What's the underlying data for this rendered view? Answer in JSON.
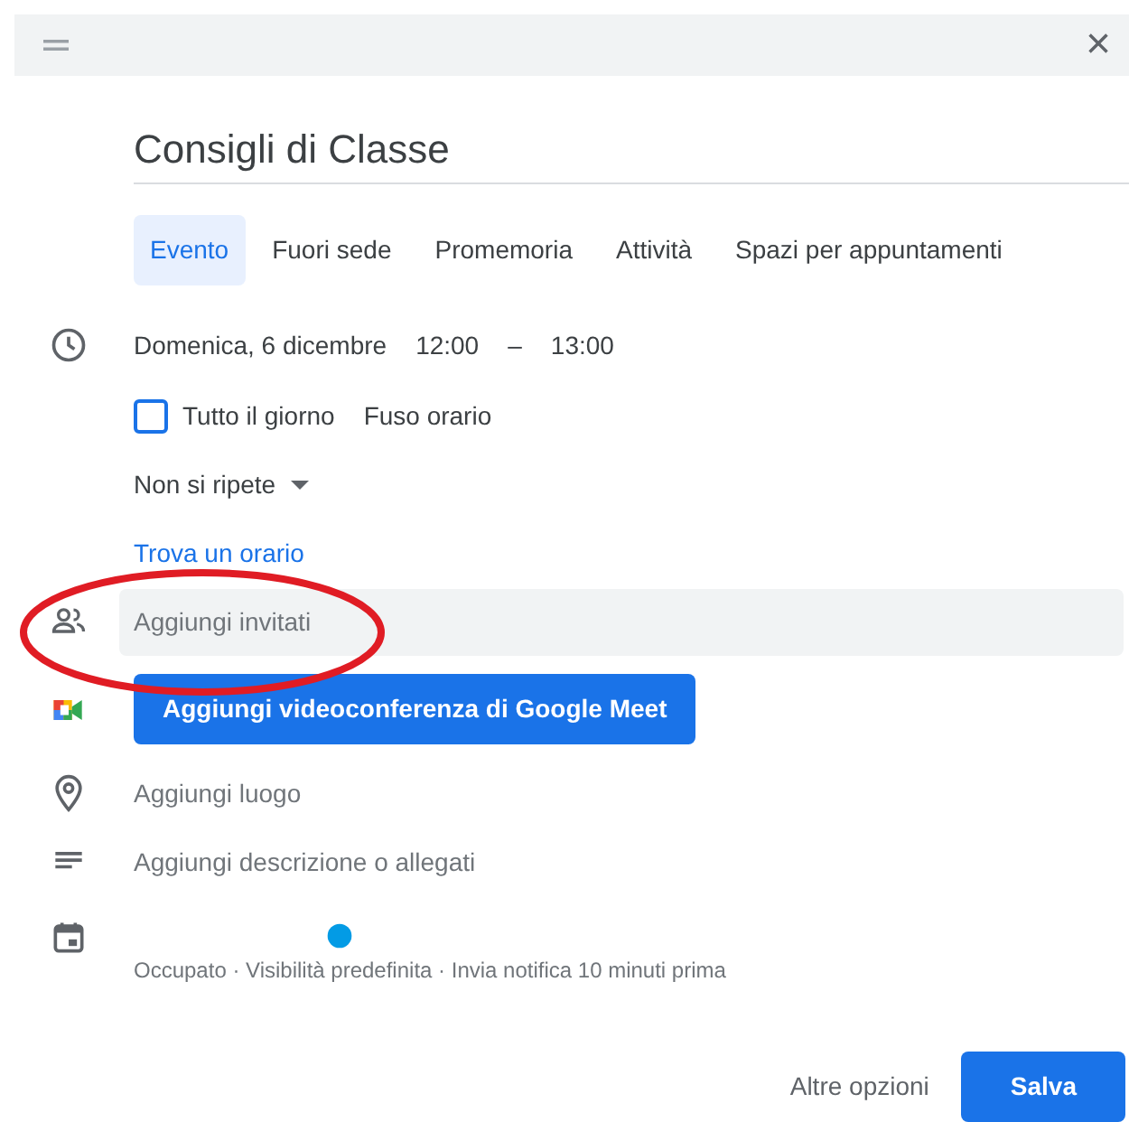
{
  "header": {
    "close_label": "×"
  },
  "title": "Consigli di Classe",
  "tabs": [
    {
      "label": "Evento",
      "selected": true
    },
    {
      "label": "Fuori sede",
      "selected": false
    },
    {
      "label": "Promemoria",
      "selected": false
    },
    {
      "label": "Attività",
      "selected": false
    },
    {
      "label": "Spazi per appuntamenti",
      "selected": false
    }
  ],
  "when": {
    "date": "Domenica, 6 dicembre",
    "start": "12:00",
    "separator": "–",
    "end": "13:00"
  },
  "all_day": {
    "label": "Tutto il giorno",
    "checked": false
  },
  "time_zone": "Fuso orario",
  "repeat": "Non si ripete",
  "find_time": "Trova un orario",
  "guests": {
    "placeholder": "Aggiungi invitati"
  },
  "meet_button": "Aggiungi videoconferenza di Google Meet",
  "location": "Aggiungi luogo",
  "description": "Aggiungi descrizione o allegati",
  "status": "Occupato · Visibilità predefinita · Invia notifica 10 minuti prima",
  "footer": {
    "more": "Altre opzioni",
    "save": "Salva"
  }
}
